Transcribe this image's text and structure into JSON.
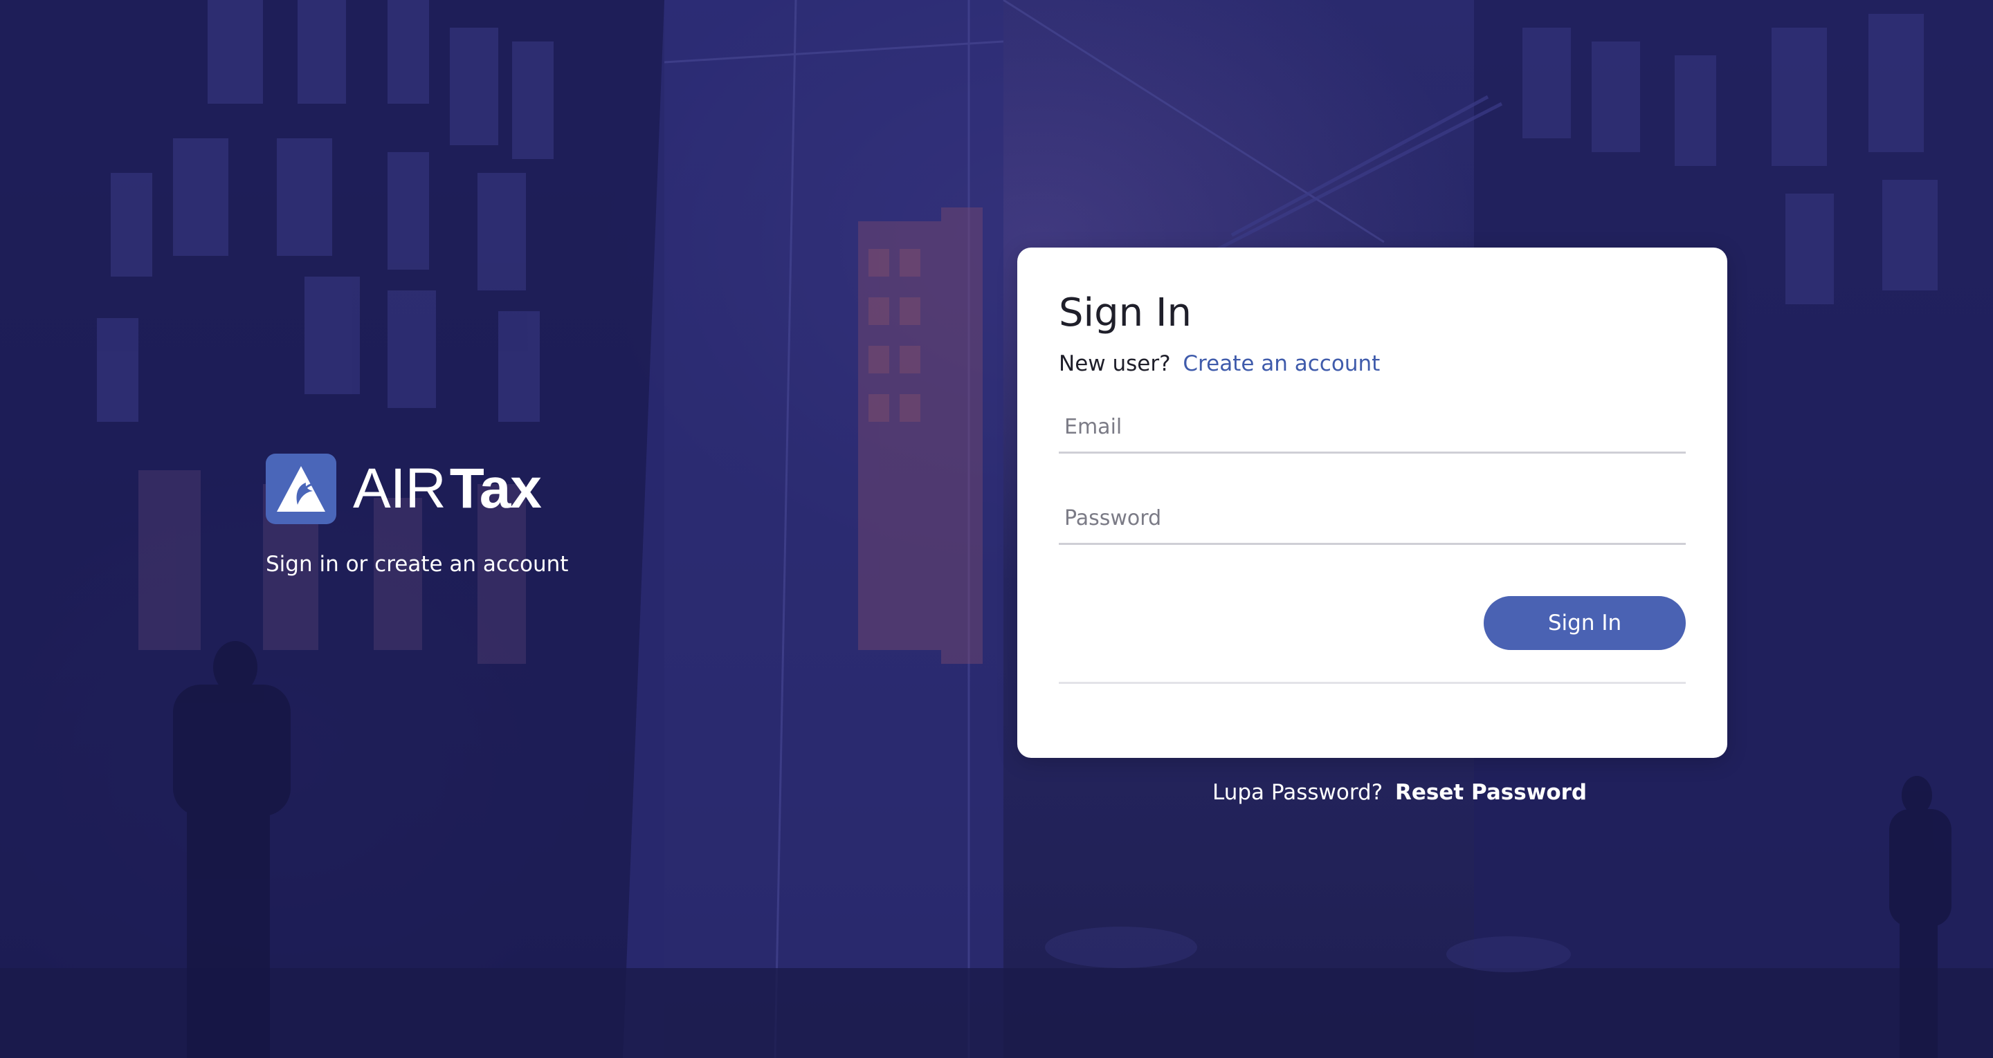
{
  "brand": {
    "name_light": "AIR",
    "name_bold": "Tax",
    "tagline": "Sign in or create an account",
    "icon": "airtax-logo-icon",
    "accent_color": "#4a66b9"
  },
  "signin": {
    "title": "Sign In",
    "new_user_prompt": "New user?",
    "create_account_link": "Create an account",
    "email_placeholder": "Email",
    "password_placeholder": "Password",
    "submit_label": "Sign In",
    "button_color": "#4a62b3",
    "link_color": "#3f5bab"
  },
  "forgot": {
    "prompt": "Lupa Password?",
    "reset_link": "Reset Password"
  },
  "background": {
    "overlay_color": "#26266a"
  }
}
